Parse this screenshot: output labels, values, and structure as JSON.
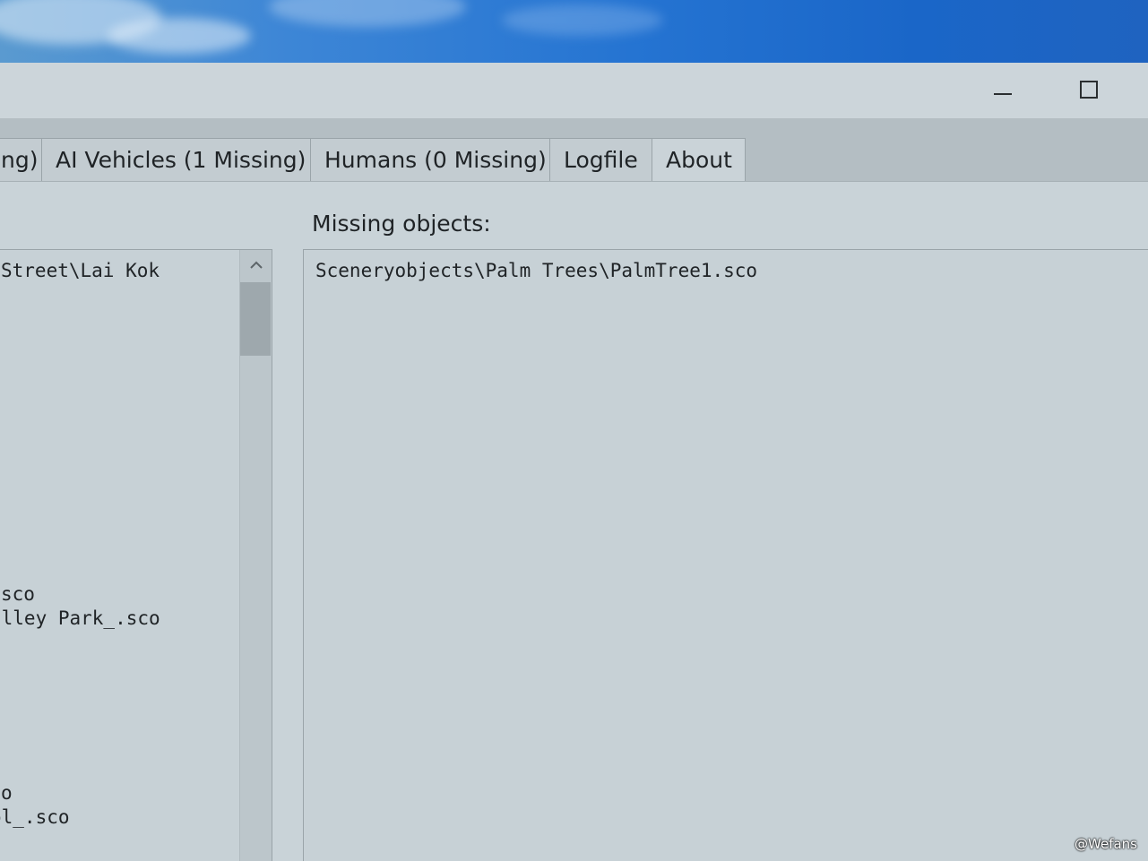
{
  "window": {
    "controls": {
      "minimize_icon": "minimize-icon",
      "maximize_icon": "maximize-icon"
    }
  },
  "tabs": [
    {
      "label": "ng)"
    },
    {
      "label": "AI Vehicles (1 Missing)"
    },
    {
      "label": "Humans (0 Missing)"
    },
    {
      "label": "Logfile"
    },
    {
      "label": "About"
    }
  ],
  "main": {
    "missing_label": "Missing objects:",
    "left_list": {
      "lines": [
        "Street\\Lai Kok",
        "sco",
        "alley Park_.sco",
        "o",
        "ol_.sco"
      ]
    },
    "missing_list": {
      "items": [
        "Sceneryobjects\\Palm Trees\\PalmTree1.sco"
      ]
    }
  },
  "watermark": "@Wefans"
}
